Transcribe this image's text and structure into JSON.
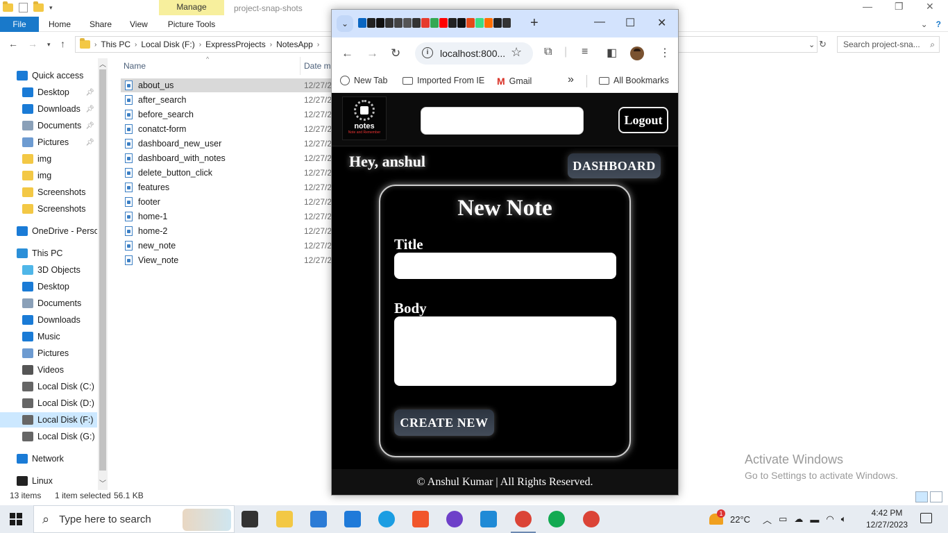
{
  "explorer": {
    "window_title": "project-snap-shots",
    "manage_tab": "Manage",
    "ribbon_tabs": [
      "File",
      "Home",
      "Share",
      "View"
    ],
    "picture_tools": "Picture Tools",
    "breadcrumb": [
      "This PC",
      "Local Disk (F:)",
      "ExpressProjects",
      "NotesApp"
    ],
    "search_placeholder": "Search project-sna...",
    "nav_items": [
      {
        "label": "Quick access",
        "icon": "star-icon",
        "color": "#1a7bd6"
      },
      {
        "label": "Desktop",
        "icon": "desktop-icon",
        "color": "#1a7bd6",
        "pinned": true
      },
      {
        "label": "Downloads",
        "icon": "download-icon",
        "color": "#1a7bd6",
        "pinned": true
      },
      {
        "label": "Documents",
        "icon": "documents-icon",
        "color": "#8aa0b8",
        "pinned": true
      },
      {
        "label": "Pictures",
        "icon": "pictures-icon",
        "color": "#6d9bd1",
        "pinned": true
      },
      {
        "label": "img",
        "icon": "folder-icon",
        "color": "#f3c845"
      },
      {
        "label": "img",
        "icon": "folder-icon",
        "color": "#f3c845"
      },
      {
        "label": "Screenshots",
        "icon": "folder-icon",
        "color": "#f3c845"
      },
      {
        "label": "Screenshots",
        "icon": "folder-icon",
        "color": "#f3c845"
      },
      {
        "label": "OneDrive - Persor",
        "icon": "onedrive-icon",
        "color": "#1a7bd6"
      },
      {
        "label": "This PC",
        "icon": "computer-icon",
        "color": "#2b8fd8"
      },
      {
        "label": "3D Objects",
        "icon": "cube-icon",
        "color": "#4fb6e8"
      },
      {
        "label": "Desktop",
        "icon": "desktop-icon",
        "color": "#1a7bd6"
      },
      {
        "label": "Documents",
        "icon": "documents-icon",
        "color": "#8aa0b8"
      },
      {
        "label": "Downloads",
        "icon": "download-icon",
        "color": "#1a7bd6"
      },
      {
        "label": "Music",
        "icon": "music-icon",
        "color": "#1a7bd6"
      },
      {
        "label": "Pictures",
        "icon": "pictures-icon",
        "color": "#6d9bd1"
      },
      {
        "label": "Videos",
        "icon": "videos-icon",
        "color": "#555555"
      },
      {
        "label": "Local Disk (C:)",
        "icon": "drive-icon",
        "color": "#666666"
      },
      {
        "label": "Local Disk (D:)",
        "icon": "drive-icon",
        "color": "#666666"
      },
      {
        "label": "Local Disk (F:)",
        "icon": "drive-icon",
        "color": "#666666",
        "selected": true
      },
      {
        "label": "Local Disk (G:)",
        "icon": "drive-icon",
        "color": "#666666"
      },
      {
        "label": "Network",
        "icon": "network-icon",
        "color": "#1a7bd6"
      },
      {
        "label": "Linux",
        "icon": "linux-icon",
        "color": "#222222"
      }
    ],
    "columns": {
      "name": "Name",
      "date": "Date m"
    },
    "files": [
      {
        "name": "about_us",
        "date": "12/27/2",
        "selected": true
      },
      {
        "name": "after_search",
        "date": "12/27/2"
      },
      {
        "name": "before_search",
        "date": "12/27/2"
      },
      {
        "name": "conatct-form",
        "date": "12/27/2"
      },
      {
        "name": "dashboard_new_user",
        "date": "12/27/2"
      },
      {
        "name": "dashboard_with_notes",
        "date": "12/27/2"
      },
      {
        "name": "delete_button_click",
        "date": "12/27/2"
      },
      {
        "name": "features",
        "date": "12/27/2"
      },
      {
        "name": "footer",
        "date": "12/27/2"
      },
      {
        "name": "home-1",
        "date": "12/27/2"
      },
      {
        "name": "home-2",
        "date": "12/27/2"
      },
      {
        "name": "new_note",
        "date": "12/27/2"
      },
      {
        "name": "View_note",
        "date": "12/27/2"
      }
    ],
    "status": {
      "count": "13 items",
      "selected": "1 item selected",
      "size": "56.1 KB"
    }
  },
  "activation": {
    "title": "Activate Windows",
    "subtitle": "Go to Settings to activate Windows."
  },
  "chrome": {
    "url": "localhost:800...",
    "bookmarks": [
      "New Tab",
      "Imported From IE",
      "Gmail",
      "All Bookmarks"
    ],
    "overflow": "»",
    "tab_favicons": [
      "#0a66c2",
      "#222222",
      "#111111",
      "#333333",
      "#444444",
      "#555555",
      "#333333",
      "#e63b2e",
      "#34a853",
      "#ff0000",
      "#222222",
      "#111111",
      "#e64a19",
      "#3ddc84",
      "#ff6f00",
      "#222222",
      "#333333"
    ]
  },
  "site": {
    "logo_text": "notes",
    "logo_tagline": "Note and Remember",
    "logout": "Logout",
    "greeting": "Hey, anshul",
    "dashboard": "DASHBOARD",
    "card_title": "New Note",
    "title_label": "Title",
    "body_label": "Body",
    "create": "CREATE NEW",
    "footer": "© Anshul Kumar | All Rights Reserved."
  },
  "taskbar": {
    "search_placeholder": "Type here to search",
    "apps": [
      {
        "name": "task-view",
        "color": "#333333"
      },
      {
        "name": "file-explorer",
        "color": "#f3c845"
      },
      {
        "name": "microsoft-store",
        "color": "#2b7bd6"
      },
      {
        "name": "mail",
        "color": "#1f7ad9"
      },
      {
        "name": "edge",
        "color": "#1b9de2"
      },
      {
        "name": "brave",
        "color": "#f1562b"
      },
      {
        "name": "github-desktop",
        "color": "#6e40c9"
      },
      {
        "name": "vscode",
        "color": "#1f8ad6"
      },
      {
        "name": "chrome",
        "color": "#db4437",
        "active": true
      },
      {
        "name": "mongodb-compass",
        "color": "#13aa52"
      },
      {
        "name": "chrome-profile",
        "color": "#db4437"
      }
    ],
    "weather": "22°C",
    "weather_badge": "1",
    "time": "4:42 PM",
    "date": "12/27/2023"
  }
}
